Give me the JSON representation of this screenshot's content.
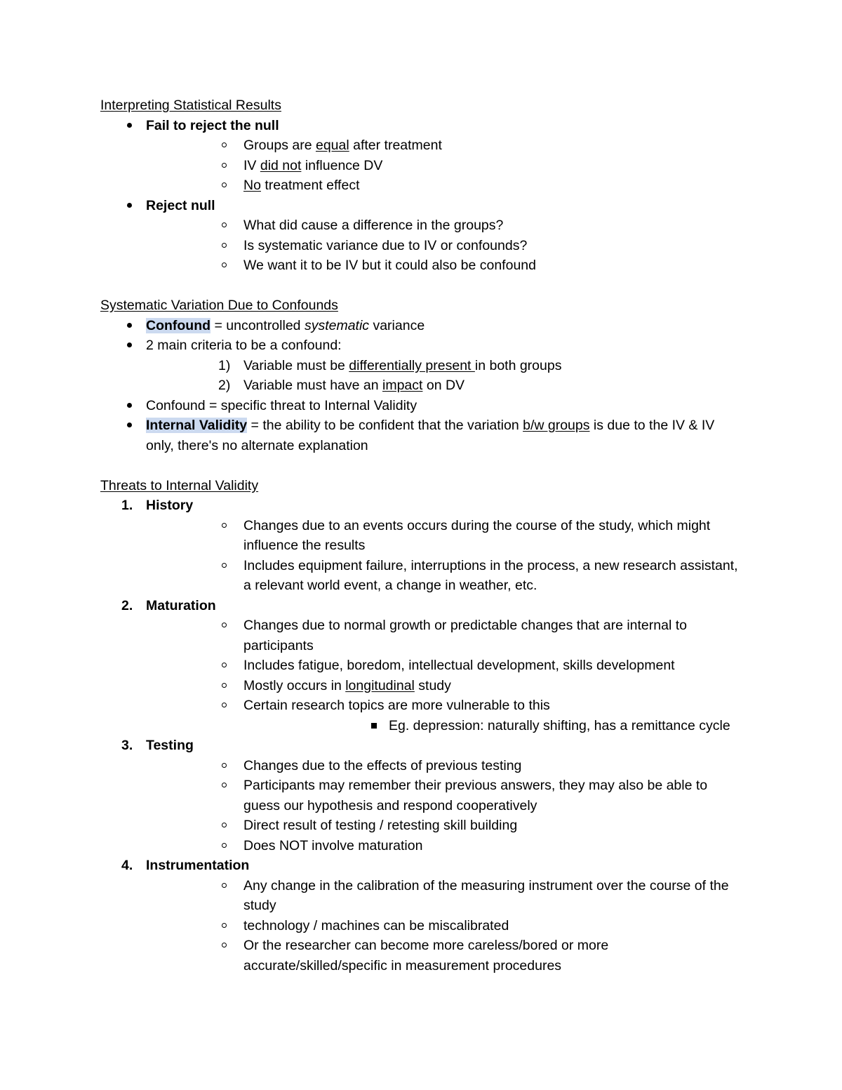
{
  "document": {
    "highlight_color": "#ccdaf0",
    "text_color": "#000000",
    "background_color": "#ffffff",
    "sections": [
      {
        "heading": "Interpreting Statistical Results",
        "items": [
          {
            "level": 1,
            "marker": "bullet",
            "text": "Fail to reject the null",
            "bold": true,
            "children": [
              {
                "level": 2,
                "marker": "circle",
                "parts": [
                  {
                    "t": "Groups are "
                  },
                  {
                    "t": "equal",
                    "underline": true
                  },
                  {
                    "t": " after treatment"
                  }
                ]
              },
              {
                "level": 2,
                "marker": "circle",
                "parts": [
                  {
                    "t": "IV "
                  },
                  {
                    "t": "did not",
                    "underline": true
                  },
                  {
                    "t": " influence DV"
                  }
                ]
              },
              {
                "level": 2,
                "marker": "circle",
                "parts": [
                  {
                    "t": "No",
                    "underline": true
                  },
                  {
                    "t": " treatment effect"
                  }
                ]
              }
            ]
          },
          {
            "level": 1,
            "marker": "bullet",
            "text": "Reject null",
            "bold": true,
            "children": [
              {
                "level": 2,
                "marker": "circle",
                "parts": [
                  {
                    "t": "What did cause a difference in the groups?"
                  }
                ]
              },
              {
                "level": 2,
                "marker": "circle",
                "parts": [
                  {
                    "t": "Is systematic variance due to IV or confounds?"
                  }
                ]
              },
              {
                "level": 2,
                "marker": "circle",
                "parts": [
                  {
                    "t": "We want it to be IV but it could also be confound"
                  }
                ]
              }
            ]
          }
        ]
      },
      {
        "heading": "Systematic Variation Due to Confounds",
        "items": [
          {
            "level": 1,
            "marker": "bullet",
            "parts": [
              {
                "t": "Confound",
                "bold": true,
                "highlight": true
              },
              {
                "t": " = uncontrolled "
              },
              {
                "t": "systematic",
                "italic": true
              },
              {
                "t": " variance"
              }
            ]
          },
          {
            "level": 1,
            "marker": "bullet",
            "parts": [
              {
                "t": "2 main criteria to be a confound:"
              }
            ],
            "children": [
              {
                "level": 2,
                "marker": "1)",
                "parts": [
                  {
                    "t": "Variable must be "
                  },
                  {
                    "t": "differentially present ",
                    "underline": true
                  },
                  {
                    "t": "in both groups"
                  }
                ]
              },
              {
                "level": 2,
                "marker": "2)",
                "parts": [
                  {
                    "t": "Variable must have an "
                  },
                  {
                    "t": "impact",
                    "underline": true
                  },
                  {
                    "t": " on DV"
                  }
                ]
              }
            ]
          },
          {
            "level": 1,
            "marker": "bullet",
            "parts": [
              {
                "t": "Confound = specific threat to Internal Validity"
              }
            ]
          },
          {
            "level": 1,
            "marker": "bullet",
            "parts": [
              {
                "t": "Internal Validity",
                "bold": true,
                "highlight": true
              },
              {
                "t": " = the ability to be confident that the variation "
              },
              {
                "t": "b/w groups",
                "underline": true
              },
              {
                "t": " is due to the IV & IV only, there's no alternate explanation"
              }
            ]
          }
        ]
      },
      {
        "heading": "Threats to Internal Validity",
        "items": [
          {
            "level": 1,
            "marker": "1.",
            "text": "History",
            "bold": true,
            "children": [
              {
                "level": 2,
                "marker": "circle",
                "parts": [
                  {
                    "t": "Changes due to an events occurs during the course of the study, which might influence the results"
                  }
                ]
              },
              {
                "level": 2,
                "marker": "circle",
                "parts": [
                  {
                    "t": "Includes equipment failure, interruptions in the process, a new research assistant, a relevant world event, a change in weather, etc."
                  }
                ]
              }
            ]
          },
          {
            "level": 1,
            "marker": "2.",
            "text": "Maturation",
            "bold": true,
            "children": [
              {
                "level": 2,
                "marker": "circle",
                "parts": [
                  {
                    "t": "Changes due to normal growth or predictable changes that are internal to participants"
                  }
                ]
              },
              {
                "level": 2,
                "marker": "circle",
                "parts": [
                  {
                    "t": "Includes fatigue, boredom, intellectual development, skills development"
                  }
                ]
              },
              {
                "level": 2,
                "marker": "circle",
                "parts": [
                  {
                    "t": "Mostly occurs in "
                  },
                  {
                    "t": "longitudinal",
                    "underline": true
                  },
                  {
                    "t": " study"
                  }
                ]
              },
              {
                "level": 2,
                "marker": "circle",
                "parts": [
                  {
                    "t": "Certain research topics are more vulnerable to this"
                  }
                ],
                "children": [
                  {
                    "level": 3,
                    "marker": "square",
                    "parts": [
                      {
                        "t": "Eg. depression: naturally shifting, has a remittance cycle"
                      }
                    ]
                  }
                ]
              }
            ]
          },
          {
            "level": 1,
            "marker": "3.",
            "text": "Testing",
            "bold": true,
            "children": [
              {
                "level": 2,
                "marker": "circle",
                "parts": [
                  {
                    "t": "Changes due to the effects of previous testing"
                  }
                ]
              },
              {
                "level": 2,
                "marker": "circle",
                "parts": [
                  {
                    "t": "Participants may remember their previous answers, they may also be able to guess our hypothesis and respond cooperatively"
                  }
                ]
              },
              {
                "level": 2,
                "marker": "circle",
                "parts": [
                  {
                    "t": "Direct result of testing / retesting skill building"
                  }
                ]
              },
              {
                "level": 2,
                "marker": "circle",
                "parts": [
                  {
                    "t": "Does NOT involve maturation"
                  }
                ]
              }
            ]
          },
          {
            "level": 1,
            "marker": "4.",
            "text": "Instrumentation",
            "bold": true,
            "children": [
              {
                "level": 2,
                "marker": "circle",
                "parts": [
                  {
                    "t": "Any change in the calibration of the measuring instrument over the course of the study"
                  }
                ]
              },
              {
                "level": 2,
                "marker": "circle",
                "parts": [
                  {
                    "t": "technology / machines can be miscalibrated"
                  }
                ]
              },
              {
                "level": 2,
                "marker": "circle",
                "parts": [
                  {
                    "t": "Or the researcher can become more careless/bored or more accurate/skilled/specific in measurement procedures"
                  }
                ]
              }
            ]
          }
        ]
      }
    ]
  }
}
